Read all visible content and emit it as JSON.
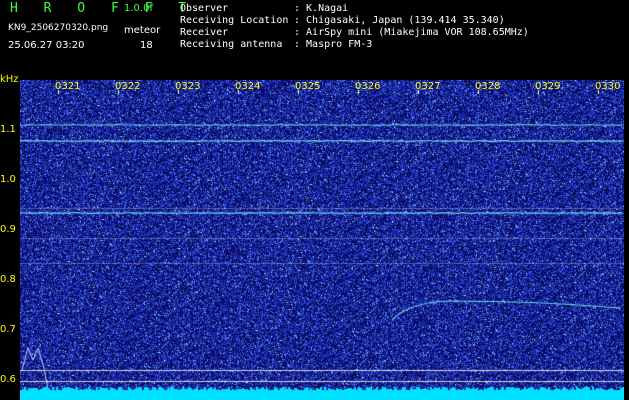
{
  "app": {
    "name": "H R O F F T",
    "version": "1.0.0f",
    "filename": "KN9_2506270320.png",
    "mode": "meteor",
    "timestamp": "25.06.27 03:20",
    "count": "18"
  },
  "station": {
    "rows": [
      {
        "label": "Observer",
        "value": ": K.Nagai"
      },
      {
        "label": "Receiving Location",
        "value": ": Chigasaki, Japan (139.414 35.340)"
      },
      {
        "label": "Receiver",
        "value": ": AirSpy mini (Miakejima VOR 108.65MHz)"
      },
      {
        "label": "Receiving antenna",
        "value": ": Maspro FM-3"
      }
    ]
  },
  "axes": {
    "unit": "kHz",
    "x_ticks": [
      "0321",
      "0322",
      "0323",
      "0324",
      "0325",
      "0326",
      "0327",
      "0328",
      "0329",
      "0330"
    ],
    "y_ticks": [
      "1.1",
      "1.0",
      "0.9",
      "0.8",
      "0.7",
      "0.6"
    ]
  },
  "colors": {
    "background": "#0a0a60",
    "noise": "#2a40d0",
    "signal": "#7ff0ff",
    "baseline": "#00e0ff",
    "label": "#ffff00",
    "brand": "#3cff3c"
  }
}
